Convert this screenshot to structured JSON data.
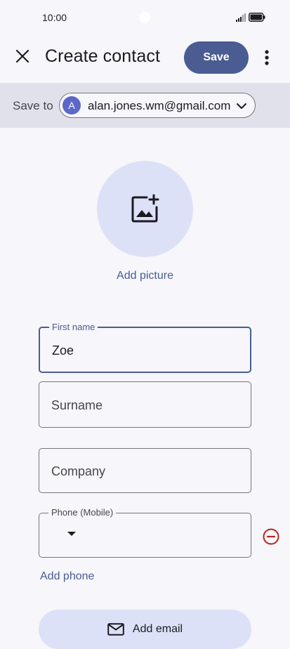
{
  "status_bar": {
    "time": "10:00",
    "icons": [
      "signal-icon",
      "battery-icon"
    ]
  },
  "app_bar": {
    "title": "Create contact",
    "save_label": "Save",
    "icons": [
      "close-icon",
      "more-vert-icon"
    ]
  },
  "save_to": {
    "label": "Save to",
    "account_initial": "A",
    "account_email": "alan.jones.wm@gmail.com",
    "chevron_icon": "chevron-down-icon"
  },
  "picture": {
    "icon": "add-photo-icon",
    "label": "Add picture"
  },
  "form": {
    "first_name": {
      "label": "First name",
      "value": "Zoe"
    },
    "surname": {
      "placeholder": "Surname"
    },
    "company": {
      "placeholder": "Company"
    },
    "phone": {
      "label": "Phone (Mobile)",
      "value": ""
    },
    "add_phone_label": "Add phone",
    "add_email_label": "Add email"
  },
  "colors": {
    "accent": "#4a5c92",
    "accent_container": "#dde1f7",
    "avatar": "#5b68c8",
    "remove": "#b3261e",
    "background": "#f6f6fb",
    "save_to_background": "#e0e1ea"
  }
}
